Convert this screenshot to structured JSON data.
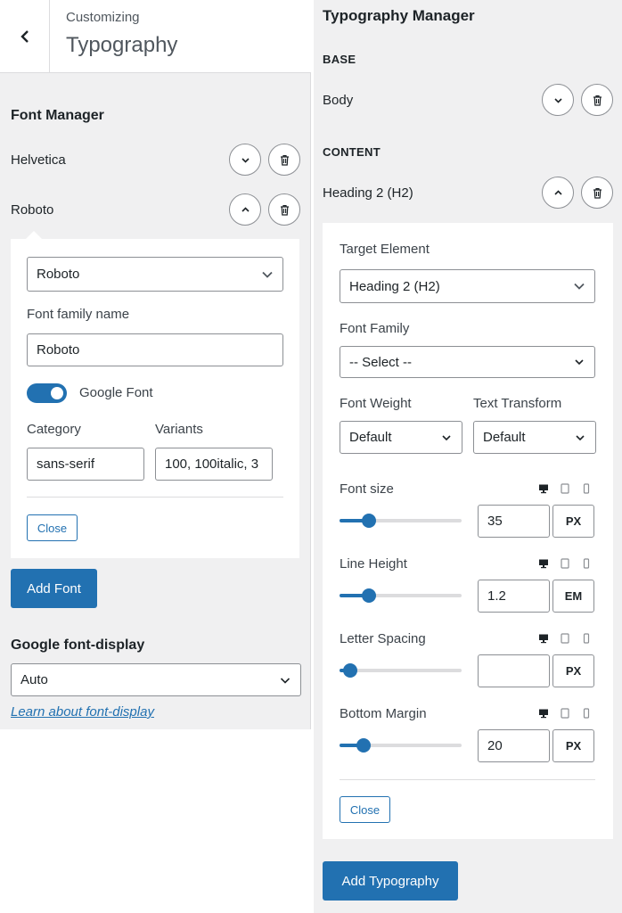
{
  "left": {
    "header": {
      "subtitle": "Customizing",
      "title": "Typography"
    },
    "font_manager": {
      "title": "Font Manager",
      "fonts": [
        {
          "name": "Helvetica",
          "expanded": false
        },
        {
          "name": "Roboto",
          "expanded": true
        }
      ],
      "editor": {
        "font_select_value": "Roboto",
        "family_name_label": "Font family name",
        "family_name_value": "Roboto",
        "google_font_label": "Google Font",
        "google_font_on": true,
        "category_label": "Category",
        "category_value": "sans-serif",
        "variants_label": "Variants",
        "variants_value": "100, 100italic, 3",
        "close_label": "Close"
      },
      "add_font_label": "Add Font"
    },
    "font_display": {
      "title": "Google font-display",
      "value": "Auto",
      "link_text": "Learn about font-display"
    }
  },
  "right": {
    "title": "Typography Manager",
    "base_caption": "BASE",
    "base_item": "Body",
    "content_caption": "CONTENT",
    "content_item": "Heading 2 (H2)",
    "editor": {
      "target_label": "Target Element",
      "target_value": "Heading 2 (H2)",
      "family_label": "Font Family",
      "family_value": "-- Select --",
      "weight_label": "Font Weight",
      "weight_value": "Default",
      "transform_label": "Text Transform",
      "transform_value": "Default",
      "font_size": {
        "label": "Font size",
        "value": "35",
        "unit": "PX",
        "slider_fraction": 0.24
      },
      "line_height": {
        "label": "Line Height",
        "value": "1.2",
        "unit": "EM",
        "slider_fraction": 0.24
      },
      "letter_spacing": {
        "label": "Letter Spacing",
        "value": "",
        "unit": "PX",
        "slider_fraction": 0.09
      },
      "bottom_margin": {
        "label": "Bottom Margin",
        "value": "20",
        "unit": "PX",
        "slider_fraction": 0.2
      },
      "close_label": "Close"
    },
    "add_label": "Add Typography"
  },
  "colors": {
    "accent": "#2271b1",
    "panel_bg": "#f0f0f1",
    "border": "#8c8f94"
  }
}
